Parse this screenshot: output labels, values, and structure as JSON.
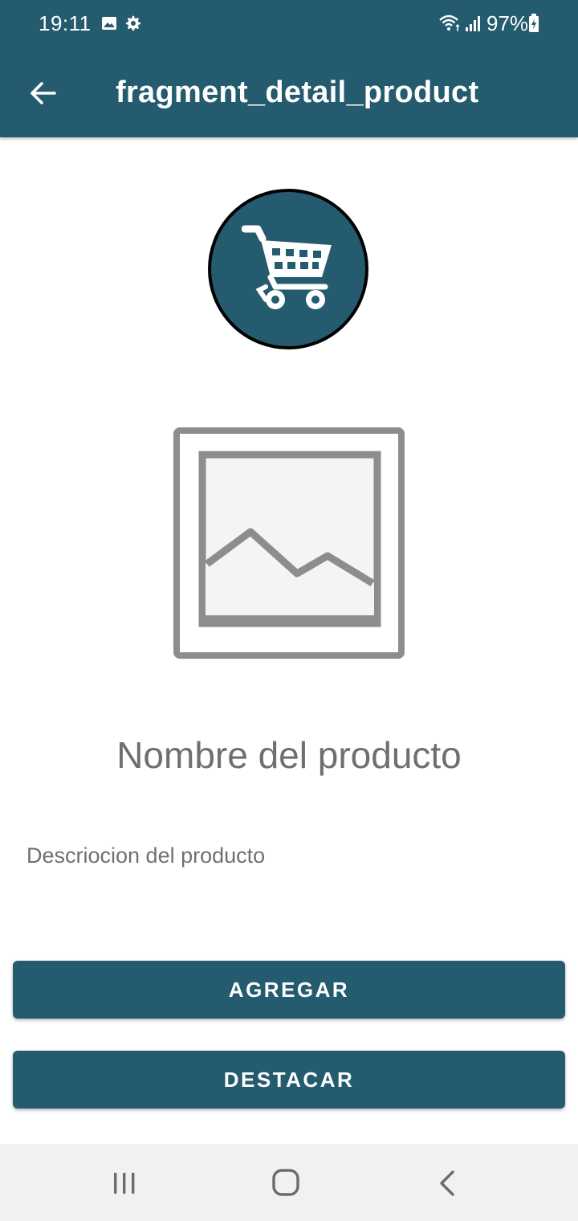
{
  "status_bar": {
    "time": "19:11",
    "battery_percent": "97%",
    "icons": [
      "image-icon",
      "gear-icon",
      "wifi-icon",
      "signal-icon",
      "battery-charging-icon"
    ]
  },
  "app_bar": {
    "title": "fragment_detail_product",
    "back_icon": "arrow-left-icon"
  },
  "product": {
    "logo_icon": "shopping-cart-icon",
    "image_icon": "image-placeholder-icon",
    "name": "Nombre del producto",
    "description": "Descriocion del producto"
  },
  "actions": {
    "add_label": "AGREGAR",
    "feature_label": "DESTACAR"
  },
  "nav_bar": {
    "icons": [
      "recents-icon",
      "home-icon",
      "back-icon"
    ]
  },
  "colors": {
    "primary": "#245b6e",
    "text_secondary": "#6f6f6f",
    "nav_background": "#f1f1f1"
  }
}
